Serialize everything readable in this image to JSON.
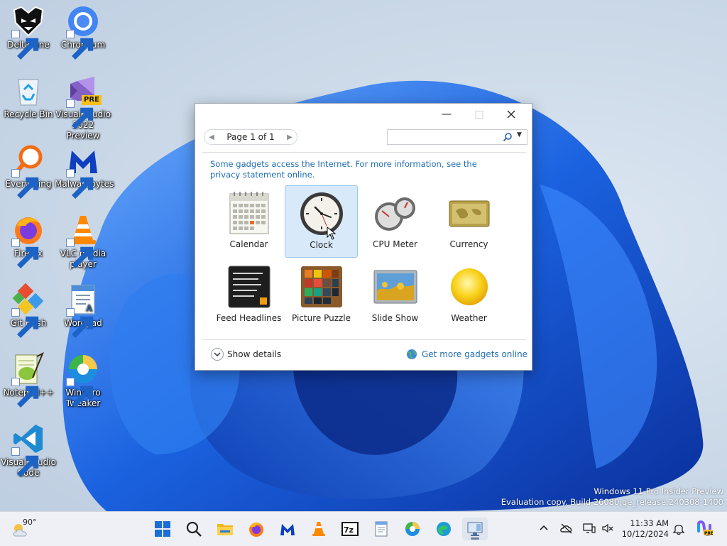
{
  "desktop": {
    "icons": [
      {
        "label": "Deltarune"
      },
      {
        "label": "Chromium"
      },
      {
        "label": "Recycle Bin"
      },
      {
        "label": "Visual Studio 2022 Preview"
      },
      {
        "label": "Everything"
      },
      {
        "label": "Malwarebytes"
      },
      {
        "label": "Firefox"
      },
      {
        "label": "VLC media player"
      },
      {
        "label": "Git Bash"
      },
      {
        "label": "Wordpad"
      },
      {
        "label": "Notepad++"
      },
      {
        "label": "Winaero Tweaker"
      },
      {
        "label": "Visual Studio Code"
      }
    ],
    "vs_badge": "PRE"
  },
  "gadget_window": {
    "pager_text": "Page 1 of 1",
    "search_placeholder": "",
    "info_text": "Some gadgets access the Internet.  For more information, see the privacy statement online.",
    "gadgets": [
      {
        "label": "Calendar",
        "selected": false
      },
      {
        "label": "Clock",
        "selected": true
      },
      {
        "label": "CPU Meter",
        "selected": false
      },
      {
        "label": "Currency",
        "selected": false
      },
      {
        "label": "Feed Headlines",
        "selected": false
      },
      {
        "label": "Picture Puzzle",
        "selected": false
      },
      {
        "label": "Slide Show",
        "selected": false
      },
      {
        "label": "Weather",
        "selected": false
      }
    ],
    "show_details_label": "Show details",
    "get_more_label": "Get more gadgets online"
  },
  "watermark": {
    "line1": "Windows 11 Pro Insider Preview",
    "line2": "Evaluation copy. Build 26080.ge_release.240308-1400"
  },
  "taskbar": {
    "weather_temp": "90°",
    "time": "11:33 AM",
    "date": "10/12/2024",
    "apps": [
      "start-icon",
      "search-icon",
      "file-explorer-icon",
      "firefox-icon",
      "malwarebytes-icon",
      "vlc-icon",
      "7zip-icon",
      "notepad-icon",
      "winaero-icon",
      "edge-icon",
      "gadgets-icon"
    ]
  },
  "colors": {
    "link": "#1f6cb3",
    "selection": "#d8e9f9",
    "wallpaper_blue": "#1a5fd6"
  }
}
